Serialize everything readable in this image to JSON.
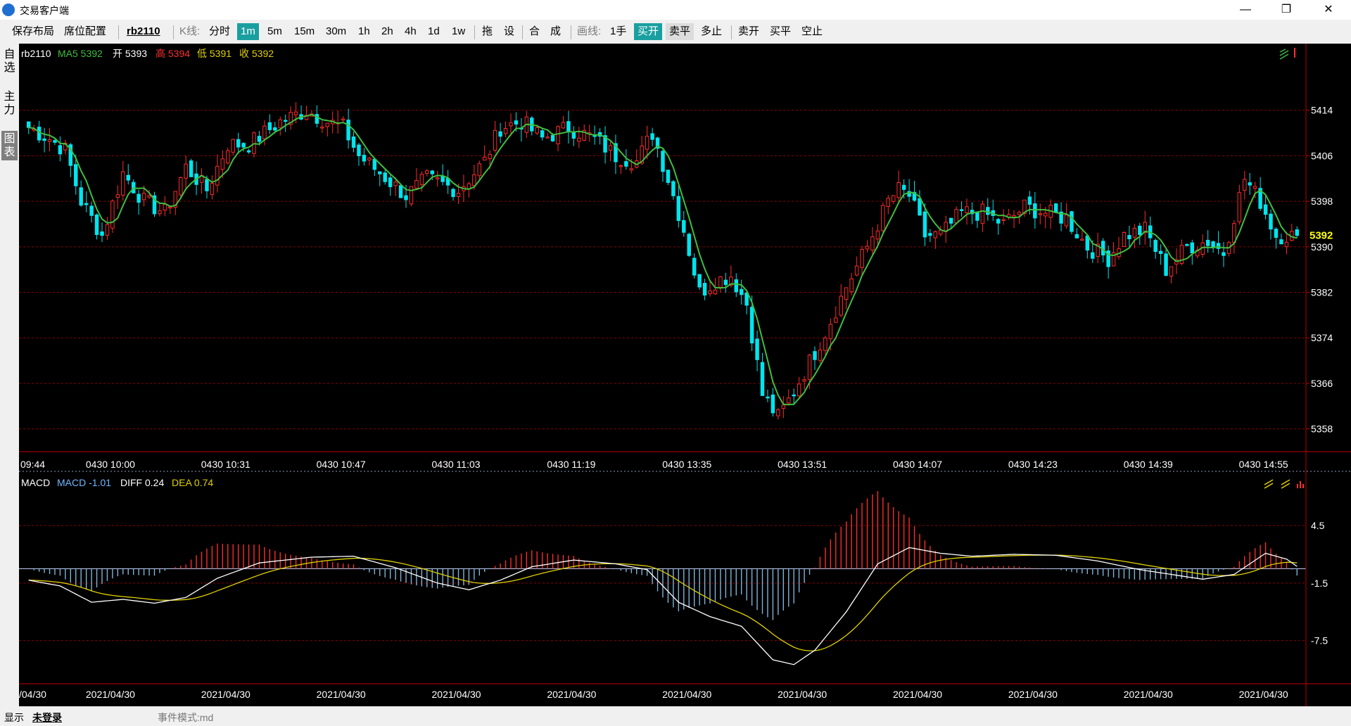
{
  "window": {
    "title": "交易客户端",
    "minimize": "—",
    "restore": "❐",
    "close": "✕"
  },
  "toolbar": {
    "save_layout": "保存布局",
    "seat_config": "席位配置",
    "symbol": "rb2110",
    "kline_label": "K线:",
    "timeframes": [
      "分时",
      "1m",
      "5m",
      "15m",
      "30m",
      "1h",
      "2h",
      "4h",
      "1d",
      "1w"
    ],
    "active_timeframe": "1m",
    "tools": [
      "拖",
      "设",
      "合",
      "成"
    ],
    "draw_label": "画线:",
    "lot": "1手",
    "buy_open": "买开",
    "sell_close": "卖平",
    "multi_stop": "多止",
    "sell_open": "卖开",
    "buy_close": "买平",
    "short_stop": "空止"
  },
  "side_tabs": [
    "自选",
    "主力",
    "图表"
  ],
  "main_panel": {
    "symbol": "rb2110",
    "ma_label": "MA5 5392",
    "open_label": "开 5393",
    "high_label": "高 5394",
    "low_label": "低 5391",
    "close_label": "收 5392",
    "last_price": "5392",
    "y_ticks": [
      "5414",
      "5406",
      "5398",
      "5390",
      "5382",
      "5374",
      "5366",
      "5358"
    ],
    "x_labels": [
      "09:44",
      "0430 10:00",
      "0430 10:31",
      "0430 10:47",
      "0430 11:03",
      "0430 11:19",
      "0430 13:35",
      "0430 13:51",
      "0430 14:07",
      "0430 14:23",
      "0430 14:39",
      "0430 14:55"
    ]
  },
  "macd_panel": {
    "title": "MACD",
    "macd_label": "MACD -1.01",
    "diff_label": "DIFF 0.24",
    "dea_label": "DEA 0.74",
    "y_ticks": [
      "4.5",
      "-1.5",
      "-7.5"
    ],
    "x_labels": [
      "/04/30",
      "2021/04/30",
      "2021/04/30",
      "2021/04/30",
      "2021/04/30",
      "2021/04/30",
      "2021/04/30",
      "2021/04/30",
      "2021/04/30",
      "2021/04/30",
      "2021/04/30",
      "2021/04/30"
    ]
  },
  "colors": {
    "up": "#ff2b2b",
    "down": "#00e5ee",
    "ma": "#3fbf3f",
    "diff": "#ffffff",
    "dea": "#e0d000",
    "grid": "#8b0000",
    "accent": "#1a9fa0"
  },
  "statusbar": {
    "display": "显示",
    "login": "未登录",
    "event_mode": "事件模式:md"
  },
  "chart_data": [
    {
      "type": "candlestick",
      "title": "rb2110 1m",
      "ylim": [
        5354,
        5422
      ],
      "anchors": [
        [
          0,
          5411
        ],
        [
          4,
          5409
        ],
        [
          7,
          5407
        ],
        [
          10,
          5398
        ],
        [
          14,
          5392
        ],
        [
          18,
          5403
        ],
        [
          22,
          5398
        ],
        [
          26,
          5396
        ],
        [
          30,
          5404
        ],
        [
          34,
          5400
        ],
        [
          38,
          5408
        ],
        [
          42,
          5408
        ],
        [
          48,
          5412
        ],
        [
          53,
          5414
        ],
        [
          57,
          5412
        ],
        [
          60,
          5411
        ],
        [
          63,
          5406
        ],
        [
          67,
          5403
        ],
        [
          72,
          5399
        ],
        [
          76,
          5402
        ],
        [
          82,
          5400
        ],
        [
          87,
          5405
        ],
        [
          90,
          5411
        ],
        [
          94,
          5412
        ],
        [
          98,
          5409
        ],
        [
          103,
          5411
        ],
        [
          108,
          5409
        ],
        [
          112,
          5406
        ],
        [
          116,
          5405
        ],
        [
          119,
          5410
        ],
        [
          122,
          5402
        ],
        [
          125,
          5393
        ],
        [
          128,
          5382
        ],
        [
          131,
          5384
        ],
        [
          134,
          5385
        ],
        [
          137,
          5380
        ],
        [
          140,
          5364
        ],
        [
          143,
          5360
        ],
        [
          145,
          5363
        ],
        [
          148,
          5368
        ],
        [
          152,
          5375
        ],
        [
          156,
          5383
        ],
        [
          160,
          5390
        ],
        [
          164,
          5398
        ],
        [
          166,
          5400
        ],
        [
          168,
          5399
        ],
        [
          171,
          5392
        ],
        [
          174,
          5392
        ],
        [
          178,
          5396
        ],
        [
          182,
          5396
        ],
        [
          186,
          5394
        ],
        [
          190,
          5397
        ],
        [
          194,
          5396
        ],
        [
          198,
          5395
        ],
        [
          202,
          5390
        ],
        [
          206,
          5388
        ],
        [
          209,
          5392
        ],
        [
          213,
          5393
        ],
        [
          217,
          5386
        ],
        [
          221,
          5390
        ],
        [
          225,
          5391
        ],
        [
          228,
          5389
        ],
        [
          232,
          5402
        ],
        [
          235,
          5398
        ],
        [
          238,
          5392
        ],
        [
          242,
          5392
        ]
      ],
      "ma_period": 5,
      "last": {
        "open": 5393,
        "high": 5394,
        "low": 5391,
        "close": 5392,
        "ma5": 5392
      }
    },
    {
      "type": "macd",
      "ylim": [
        -12,
        10
      ],
      "anchors": [
        [
          0,
          -1.2
        ],
        [
          6,
          -1.8
        ],
        [
          12,
          -3.5
        ],
        [
          18,
          -3.2
        ],
        [
          24,
          -3.6
        ],
        [
          30,
          -3.0
        ],
        [
          36,
          -1.0
        ],
        [
          44,
          0.6
        ],
        [
          54,
          1.2
        ],
        [
          62,
          1.3
        ],
        [
          70,
          0.1
        ],
        [
          78,
          -1.5
        ],
        [
          84,
          -2.2
        ],
        [
          90,
          -1.2
        ],
        [
          96,
          0.2
        ],
        [
          104,
          0.9
        ],
        [
          112,
          0.5
        ],
        [
          118,
          -0.1
        ],
        [
          124,
          -3.5
        ],
        [
          130,
          -5.0
        ],
        [
          136,
          -6.0
        ],
        [
          142,
          -9.5
        ],
        [
          146,
          -10.0
        ],
        [
          150,
          -8.5
        ],
        [
          156,
          -4.5
        ],
        [
          162,
          0.5
        ],
        [
          168,
          2.2
        ],
        [
          174,
          1.6
        ],
        [
          180,
          1.3
        ],
        [
          188,
          1.5
        ],
        [
          196,
          1.4
        ],
        [
          204,
          0.8
        ],
        [
          212,
          -0.1
        ],
        [
          218,
          -0.6
        ],
        [
          224,
          -1.1
        ],
        [
          230,
          -0.6
        ],
        [
          236,
          1.6
        ],
        [
          240,
          1.0
        ],
        [
          242,
          0.24
        ]
      ],
      "diff": 0.24,
      "dea": 0.74,
      "macd": -1.01
    }
  ]
}
